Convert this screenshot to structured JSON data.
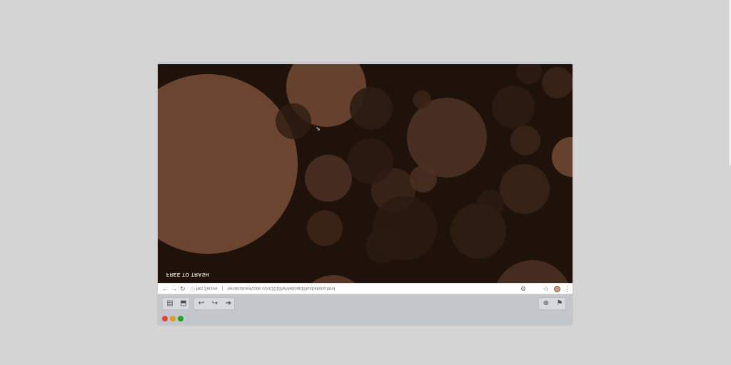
{
  "page": {
    "watermark": "FREE TO TRASH",
    "cursor_glyph": "⇗"
  },
  "browser": {
    "nav": {
      "back_icon": "←",
      "forward_icon": "→",
      "reload_icon": "↻"
    },
    "security": {
      "icon": "ⓘ",
      "label": "Not Secure"
    },
    "url": "lemonsliceofcode.com/2018/whiteboard/illustrations.html",
    "actions": {
      "extension_icon": "⚙",
      "star_icon": "☆",
      "menu_icon": "⋮"
    }
  },
  "toolbar": {
    "left_group_1": [
      "▤",
      "⬒"
    ],
    "left_group_2": [
      "↩",
      "↪",
      "➔"
    ],
    "right_group": [
      "⊕",
      "⚑"
    ]
  },
  "traffic_lights": {
    "close": "#e0443e",
    "minimize": "#dea123",
    "maximize": "#1aab29"
  },
  "colors": {
    "bubble_main": "#6b4530",
    "background": "#1e120a"
  }
}
